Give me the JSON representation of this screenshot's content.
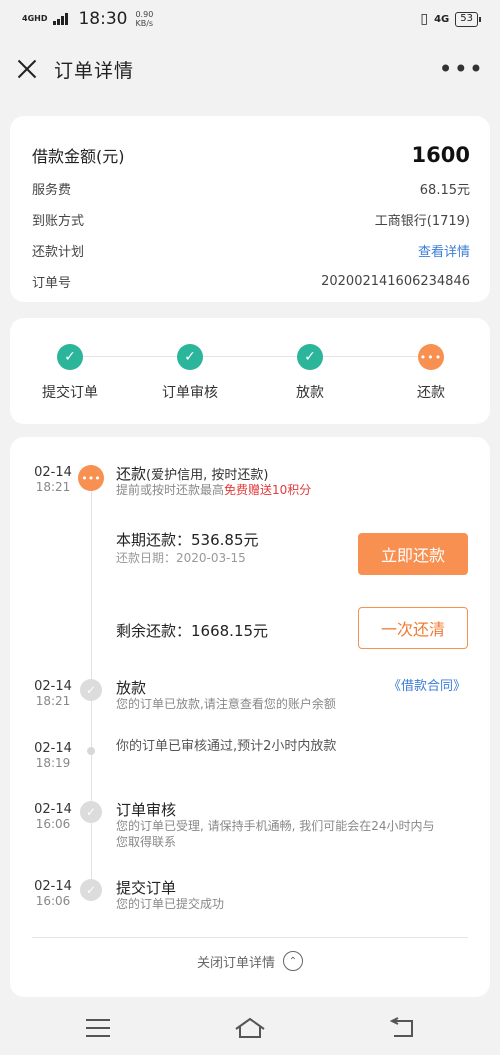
{
  "status_bar": {
    "network": "4GHD",
    "time": "18:30",
    "speed": "0.90\nKB/s",
    "signal": "4G",
    "battery": "53"
  },
  "header": {
    "title": "订单详情",
    "more": "•••"
  },
  "loan_info": {
    "amount_label": "借款金额(元)",
    "amount_value": "1600",
    "rows": [
      {
        "label": "服务费",
        "value": "68.15元"
      },
      {
        "label": "到账方式",
        "value": "工商银行(1719)"
      },
      {
        "label": "还款计划",
        "value": "查看详情"
      },
      {
        "label": "订单号",
        "value": "202002141606234846"
      }
    ]
  },
  "steps": [
    {
      "label": "提交订单",
      "state": "done"
    },
    {
      "label": "订单审核",
      "state": "done"
    },
    {
      "label": "放款",
      "state": "done"
    },
    {
      "label": "还款",
      "state": "current"
    }
  ],
  "timeline": {
    "repay": {
      "date": "02-14",
      "time": "18:21",
      "title": "还款",
      "subtitle": "(爱护信用, 按时还款)",
      "desc_prefix": "提前或按时还款最高",
      "desc_highlight": "免费赠送10积分",
      "current_label": "本期还款：536.85元",
      "current_date": "还款日期：2020-03-15",
      "pay_button": "立即还款",
      "remaining_label": "剩余还款：1668.15元",
      "payall_button": "一次还清"
    },
    "loan": {
      "date": "02-14",
      "time": "18:21",
      "title": "放款",
      "contract_link": "《借款合同》",
      "desc": "您的订单已放款,请注意查看您的账户余额"
    },
    "approved": {
      "date": "02-14",
      "time": "18:19",
      "desc": "你的订单已审核通过,预计2小时内放款"
    },
    "review": {
      "date": "02-14",
      "time": "16:06",
      "title": "订单审核",
      "desc": "您的订单已受理, 请保持手机通畅, 我们可能会在24小时内与您取得联系"
    },
    "submit": {
      "date": "02-14",
      "time": "16:06",
      "title": "提交订单",
      "desc": "您的订单已提交成功"
    }
  },
  "footer": {
    "close_detail": "关闭订单详情"
  },
  "colors": {
    "accent": "#f79050",
    "done": "#2bb59b",
    "link": "#3b7dd8",
    "highlight": "#e23b3b"
  }
}
